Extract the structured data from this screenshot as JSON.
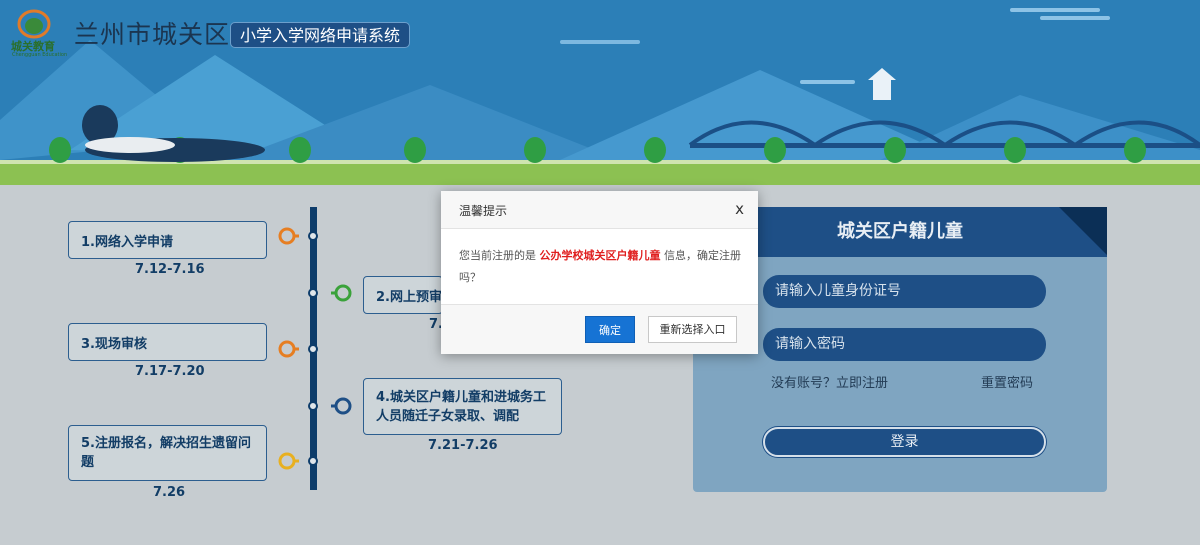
{
  "header": {
    "logo_text": "城关教育",
    "logo_sub": "Chengguan Education",
    "city_title": "兰州市城关区",
    "system_name": "小学入学网络申请系统"
  },
  "timeline": {
    "steps": [
      {
        "label": "1.网络入学申请",
        "date": "7.12-7.16"
      },
      {
        "label": "2.网上预审",
        "date": "7."
      },
      {
        "label": "3.现场审核",
        "date": "7.17-7.20"
      },
      {
        "label": "4.城关区户籍儿童和进城务工人员随迁子女录取、调配",
        "date": "7.21-7.26"
      },
      {
        "label": "5.注册报名，解决招生遗留问题",
        "date": "7.26"
      }
    ]
  },
  "login": {
    "title": "城关区户籍儿童",
    "id_placeholder": "请输入儿童身份证号",
    "password_placeholder": "请输入密码",
    "register_link": "没有账号？立即注册",
    "reset_link": "重置密码",
    "login_button": "登录"
  },
  "modal": {
    "title": "温馨提示",
    "close": "x",
    "message_prefix": "您当前注册的是",
    "message_highlight": "公办学校城关区户籍儿童",
    "message_suffix": "信息，确定注册吗？",
    "ok_button": "确定",
    "reselect_button": "重新选择入口"
  },
  "colors": {
    "banner_sky": "#2c7fb7",
    "primary_navy": "#1e4f86",
    "ok_blue": "#1673d4",
    "highlight_red": "#e02020"
  }
}
